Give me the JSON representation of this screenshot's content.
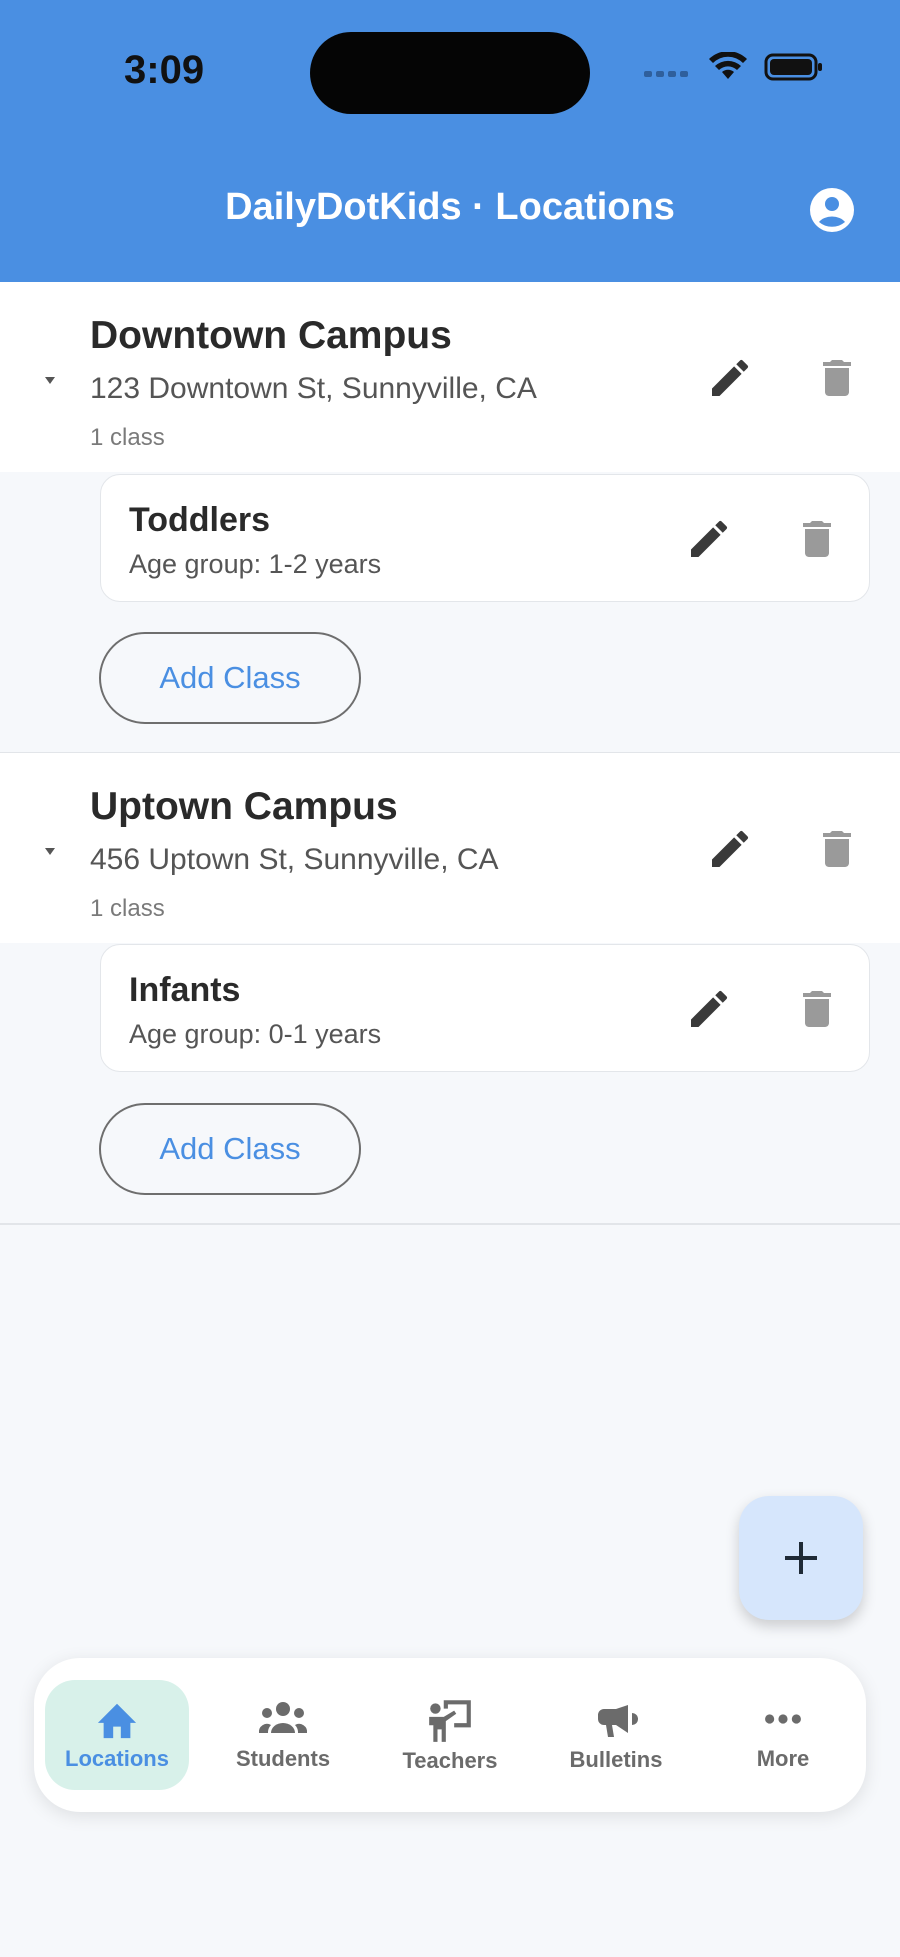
{
  "status_bar": {
    "time": "3:09"
  },
  "header": {
    "title": "DailyDotKids · Locations"
  },
  "locations": [
    {
      "name": "Downtown Campus",
      "address": "123 Downtown St, Sunnyville, CA",
      "class_count": "1 class",
      "classes": [
        {
          "name": "Toddlers",
          "age_group": "Age group: 1-2 years"
        }
      ],
      "add_class_label": "Add Class"
    },
    {
      "name": "Uptown Campus",
      "address": "456 Uptown St, Sunnyville, CA",
      "class_count": "1 class",
      "classes": [
        {
          "name": "Infants",
          "age_group": "Age group: 0-1 years"
        }
      ],
      "add_class_label": "Add Class"
    }
  ],
  "fab": {
    "icon": "plus-icon"
  },
  "bottom_nav": {
    "items": [
      {
        "label": "Locations",
        "icon": "home-icon",
        "active": true
      },
      {
        "label": "Students",
        "icon": "people-icon",
        "active": false
      },
      {
        "label": "Teachers",
        "icon": "teacher-icon",
        "active": false
      },
      {
        "label": "Bulletins",
        "icon": "megaphone-icon",
        "active": false
      },
      {
        "label": "More",
        "icon": "more-icon",
        "active": false
      }
    ]
  },
  "colors": {
    "primary": "#4a8fe2",
    "background": "#f6f8fb",
    "active_tab_bg": "#d8f1ea",
    "fab_bg": "#d6e6fc"
  }
}
